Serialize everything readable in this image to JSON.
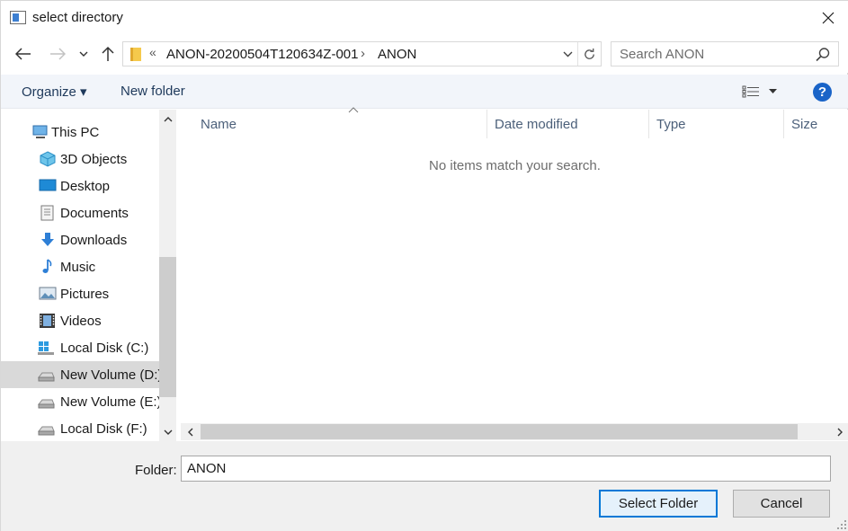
{
  "window": {
    "title": "select directory"
  },
  "navigation": {
    "address": {
      "overflow": "«",
      "segments": [
        "ANON-20200504T120634Z-001",
        "ANON"
      ],
      "separator": "›"
    },
    "search": {
      "placeholder": "Search ANON"
    }
  },
  "toolbar": {
    "organize_label": "Organize ▾",
    "new_folder_label": "New folder",
    "help_label": "?"
  },
  "tree": {
    "items": [
      {
        "label": "This PC",
        "icon": "computer-icon"
      },
      {
        "label": "3D Objects",
        "icon": "cube-icon"
      },
      {
        "label": "Desktop",
        "icon": "desktop-icon"
      },
      {
        "label": "Documents",
        "icon": "document-icon"
      },
      {
        "label": "Downloads",
        "icon": "download-arrow-icon"
      },
      {
        "label": "Music",
        "icon": "music-note-icon"
      },
      {
        "label": "Pictures",
        "icon": "picture-icon"
      },
      {
        "label": "Videos",
        "icon": "film-icon"
      },
      {
        "label": "Local Disk (C:)",
        "icon": "windows-drive-icon"
      },
      {
        "label": "New Volume (D:)",
        "icon": "drive-icon",
        "selected": true
      },
      {
        "label": "New Volume (E:)",
        "icon": "drive-icon"
      },
      {
        "label": "Local Disk (F:)",
        "icon": "drive-icon"
      }
    ]
  },
  "filelist": {
    "columns": [
      "Name",
      "Date modified",
      "Type",
      "Size"
    ],
    "empty_message": "No items match your search."
  },
  "footer": {
    "folder_label": "Folder:",
    "folder_value": "ANON",
    "select_label": "Select Folder",
    "cancel_label": "Cancel"
  },
  "colors": {
    "accent": "#0078d7",
    "toolbar_bg": "#f2f5fa",
    "selected_bg": "#d9d9d9",
    "help_blue": "#1a64c8"
  }
}
